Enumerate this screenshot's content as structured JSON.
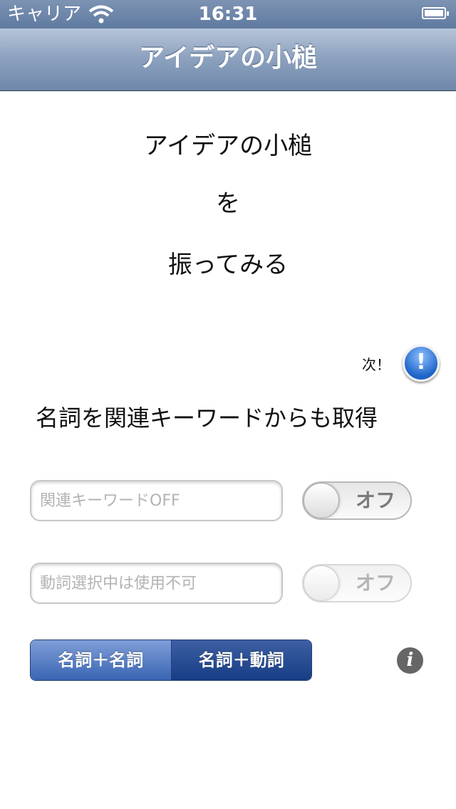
{
  "status_bar": {
    "carrier": "キャリア",
    "time": "16:31",
    "wifi_icon": "wifi-icon",
    "battery_icon": "battery-icon"
  },
  "nav": {
    "title": "アイデアの小槌"
  },
  "main": {
    "lines": [
      "アイデアの小槌",
      "を",
      "振ってみる"
    ],
    "next_label": "次！",
    "next_button_symbol": "!",
    "heading": "名詞を関連キーワードからも取得"
  },
  "fields": [
    {
      "placeholder": "関連キーワードOFF",
      "value": ""
    },
    {
      "placeholder": "動詞選択中は使用不可",
      "value": ""
    }
  ],
  "switches": [
    {
      "label": "オフ",
      "state": "off",
      "enabled": true
    },
    {
      "label": "オフ",
      "state": "off",
      "enabled": false
    }
  ],
  "segment": {
    "options": [
      "名詞＋名詞",
      "名詞＋動詞"
    ],
    "selected_index": 1
  },
  "info_button": {
    "symbol": "i"
  },
  "colors": {
    "nav_bar": "#7d93b3",
    "accent": "#1e63c8",
    "segment_selected": "#173d85"
  }
}
